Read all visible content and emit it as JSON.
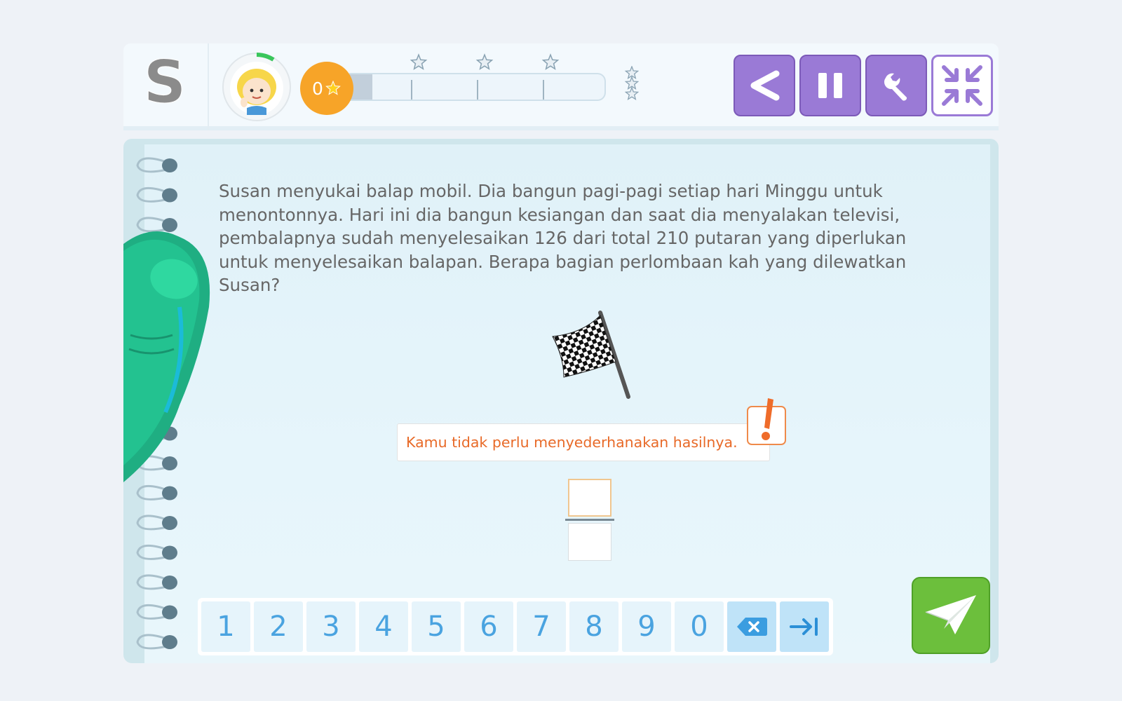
{
  "header": {
    "logo_letter": "S",
    "coins": "0",
    "progress": 0.09,
    "progress_stars": 3
  },
  "controls": {
    "back": "back-arrow-icon",
    "pause": "pause-icon",
    "settings": "wrench-icon",
    "minimize": "collapse-icon"
  },
  "question": {
    "text": "Susan menyukai balap mobil. Dia bangun pagi-pagi setiap hari Minggu untuk menontonnya. Hari ini dia bangun kesiangan dan saat dia menyalakan televisi, pembalapnya sudah menyelesaikan 126 dari total 210 putaran yang diperlukan untuk menyelesaikan balapan. Berapa bagian perlombaan kah yang dilewatkan Susan?",
    "hint": "Kamu tidak perlu menyederhanakan hasilnya."
  },
  "answer": {
    "numerator": "",
    "denominator": ""
  },
  "keypad": {
    "keys": [
      "1",
      "2",
      "3",
      "4",
      "5",
      "6",
      "7",
      "8",
      "9",
      "0"
    ],
    "backspace_icon": "backspace-icon",
    "tab_icon": "tab-next-icon"
  },
  "colors": {
    "accent_purple": "#9a7ad6",
    "coin_orange": "#f7a428",
    "hint_orange": "#e86a28",
    "send_green": "#6cbf3c",
    "key_blue": "#4aa3e0"
  }
}
